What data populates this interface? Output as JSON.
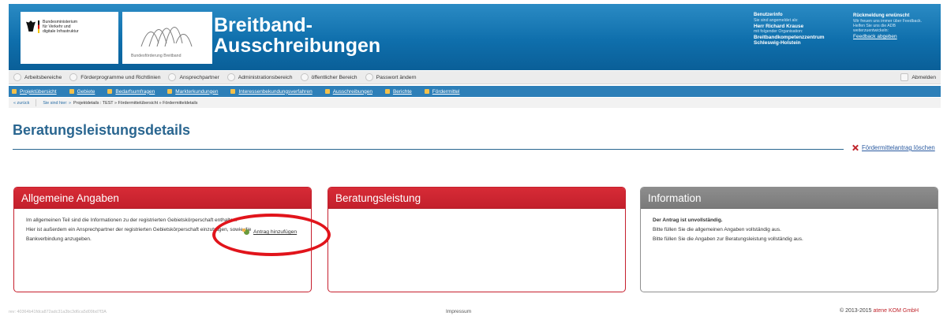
{
  "header": {
    "ministry_lines": [
      "Bundesministerium",
      "für Verkehr und",
      "digitale Infrastruktur"
    ],
    "program_logo_text": "Bundesförderung Breitband",
    "title_line1": "Breitband-",
    "title_line2": "Ausschreibungen",
    "user_info": {
      "heading": "Benutzerinfo",
      "logged_in_label": "Sie sind angemeldet als:",
      "user_name": "Herr Richard Krause",
      "org_label": "mit folgender Organisation:",
      "org_name_line1": "Breitbandkompetenzzentrum",
      "org_name_line2": "Schleswig-Holstein"
    },
    "feedback": {
      "heading": "Rückmeldung erwünscht",
      "text_line1": "Wir freuen uns immer über Feedback.",
      "text_line2": "Helfen Sie uns die ADB",
      "text_line3": "weiterzuentwickeln:",
      "link": "Feedback abgeben"
    }
  },
  "top_nav": {
    "items": [
      "Arbeitsbereiche",
      "Förderprogramme und Richtlinien",
      "Ansprechpartner",
      "Administrationsbereich",
      "öffentlicher Bereich",
      "Passwort ändern"
    ],
    "logout": "Abmelden"
  },
  "sub_nav": {
    "items": [
      "Projektübersicht",
      "Gebiete",
      "Bedarfsumfragen",
      "Markterkundungen",
      "Interessenbekundungsverfahren",
      "Ausschreibungen",
      "Berichte",
      "Fördermittel"
    ]
  },
  "breadcrumb": {
    "back": "« zurück",
    "label": "Sie sind hier: »",
    "path": "Projektdetails : TEST » Fördermittelübersicht » Fördermitteldetails"
  },
  "page": {
    "title": "Beratungsleistungsdetails",
    "delete_link": "Fördermittelantrag löschen"
  },
  "panels": {
    "general": {
      "title": "Allgemeine Angaben",
      "text1": "Im allgemeinen Teil sind die Informationen zu der registrierten Gebietskörperschaft enthalten.",
      "text2": "Hier ist außerdem ein Ansprechpartner der registrierten Gebietskörperschaft einzutragen, sowie die",
      "text3": "Bankverbindung anzugeben.",
      "add_link": "Antrag hinzufügen"
    },
    "consulting": {
      "title": "Beratungsleistung"
    },
    "information": {
      "title": "Information",
      "line1": "Der Antrag ist unvollständig.",
      "line2": "Bitte füllen Sie die allgemeinen Angaben vollständig aus.",
      "line3": "Bitte füllen Sie die Angaben zur Beratungsleistung vollständig aus."
    }
  },
  "footer": {
    "version": "rev: 40364b41fdca872adc31a3bc3d6ca5d09bd7f3A",
    "imprint": "Impressum",
    "copyright": "© 2013-2015",
    "company": "atene KOM GmbH"
  },
  "colors": {
    "header_blue": "#0f6fac",
    "panel_red": "#c61f2d",
    "panel_grey": "#7a7a7a",
    "annotation_red": "#e1141b"
  }
}
